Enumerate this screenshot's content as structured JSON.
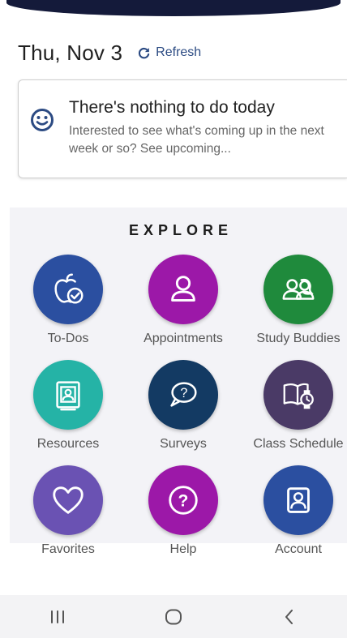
{
  "header": {
    "date": "Thu, Nov 3",
    "refresh_label": "Refresh"
  },
  "notice": {
    "icon": "smiley-icon",
    "title": "There's nothing to do today",
    "body": "Interested to see what's coming up in the next week or so? See upcoming..."
  },
  "explore": {
    "title": "EXPLORE",
    "tiles": [
      {
        "label": "To-Dos",
        "icon": "apple-check-icon",
        "color": "#2b4fa0"
      },
      {
        "label": "Appointments",
        "icon": "person-icon",
        "color": "#9c18a8"
      },
      {
        "label": "Study Buddies",
        "icon": "people-icon",
        "color": "#1f8a3c"
      },
      {
        "label": "Resources",
        "icon": "id-card-icon",
        "color": "#25b3a6"
      },
      {
        "label": "Surveys",
        "icon": "question-bubble-icon",
        "color": "#133a63"
      },
      {
        "label": "Class Schedule",
        "icon": "book-watch-icon",
        "color": "#4a3a66"
      },
      {
        "label": "Favorites",
        "icon": "heart-icon",
        "color": "#6a52b3"
      },
      {
        "label": "Help",
        "icon": "help-icon",
        "color": "#9c18a8"
      },
      {
        "label": "Account",
        "icon": "account-portrait-icon",
        "color": "#2b4fa0"
      }
    ]
  },
  "colors": {
    "accent": "#2c4b83",
    "top_bar": "#141a3a",
    "explore_bg": "#f3f3f7"
  },
  "navbar": {
    "buttons": [
      "recent-apps-icon",
      "home-icon",
      "back-icon"
    ]
  }
}
